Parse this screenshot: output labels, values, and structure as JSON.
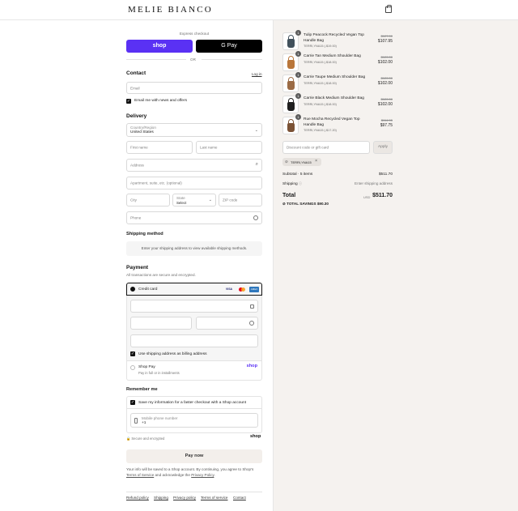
{
  "header": {
    "logo": "MELIE BIANCO"
  },
  "express": {
    "label": "Express checkout",
    "shop_pay": "shop",
    "google_pay": "G Pay",
    "or": "OR"
  },
  "contact": {
    "heading": "Contact",
    "login": "Log in",
    "email_placeholder": "Email",
    "newsletter": "Email me with news and offers"
  },
  "delivery": {
    "heading": "Delivery",
    "country_label": "Country/Region",
    "country_value": "United States",
    "first_name": "First name",
    "last_name": "Last name",
    "address": "Address",
    "apartment": "Apartment, suite, etc. (optional)",
    "city": "City",
    "state_label": "State",
    "state_value": "Select",
    "zip": "ZIP code",
    "phone": "Phone"
  },
  "shipping_method": {
    "heading": "Shipping method",
    "message": "Enter your shipping address to view available shipping methods."
  },
  "payment": {
    "heading": "Payment",
    "subtitle": "All transactions are secure and encrypted.",
    "credit_card": "Credit card",
    "card_brands": [
      "VISA",
      "MC",
      "AMEX"
    ],
    "billing_same": "Use shipping address as billing address",
    "shop_pay": "Shop Pay",
    "shop_pay_sub": "Pay in full or in installments",
    "shop_pay_logo": "shop"
  },
  "remember": {
    "heading": "Remember me",
    "save_info": "Save my information for a faster checkout with a Shop account",
    "mobile_label": "Mobile phone number",
    "mobile_value": "+1",
    "secure": "Secure and encrypted",
    "shop_logo": "shop"
  },
  "pay_now": "Pay now",
  "terms": {
    "line1": "Your info will be saved to a Shop account. By continuing, you agree to Shop's",
    "tos": "Terms of Service",
    "and": "and acknowledge the",
    "privacy": "Privacy Policy",
    "period": "."
  },
  "footer": [
    "Refund policy",
    "Shipping",
    "Privacy policy",
    "Terms of service",
    "Contact"
  ],
  "order": {
    "items": [
      {
        "name": "Tulip Peacock Recycled Vegan Top Handle Bag",
        "discount": "TERRI,YNA15 (-$19.00)",
        "original": "$127.00",
        "price": "$107.95",
        "qty": "1",
        "color": "#41515c"
      },
      {
        "name": "Carrie Tan Medium Shoulder Bag",
        "discount": "TERRI,YNA15 (-$18.00)",
        "original": "$120.00",
        "price": "$102.00",
        "qty": "1",
        "color": "#b9763a"
      },
      {
        "name": "Carrie Taupe Medium Shoulder Bag",
        "discount": "TERRI,YNA15 (-$18.00)",
        "original": "$120.00",
        "price": "$102.00",
        "qty": "1",
        "color": "#9b6b45"
      },
      {
        "name": "Carrie Black Medium Shoulder Bag",
        "discount": "TERRI,YNA15 (-$18.00)",
        "original": "$120.00",
        "price": "$102.00",
        "qty": "1",
        "color": "#1f1f1f"
      },
      {
        "name": "Rue Mocha Recycled Vegan Top Handle Bag",
        "discount": "TERRI,YNA15 (-$17.20)",
        "original": "$114.95",
        "price": "$97.75",
        "qty": "1",
        "color": "#7b5235"
      }
    ],
    "discount_placeholder": "Discount code or gift card",
    "apply": "Apply",
    "applied_code": "TERRI,YNA15",
    "subtotal_label": "Subtotal · 5 items",
    "subtotal": "$511.70",
    "shipping_label": "Shipping",
    "shipping_value": "Enter shipping address",
    "total_label": "Total",
    "currency": "USD",
    "total": "$511.70",
    "savings_label": "TOTAL SAVINGS",
    "savings": "$90.30"
  }
}
